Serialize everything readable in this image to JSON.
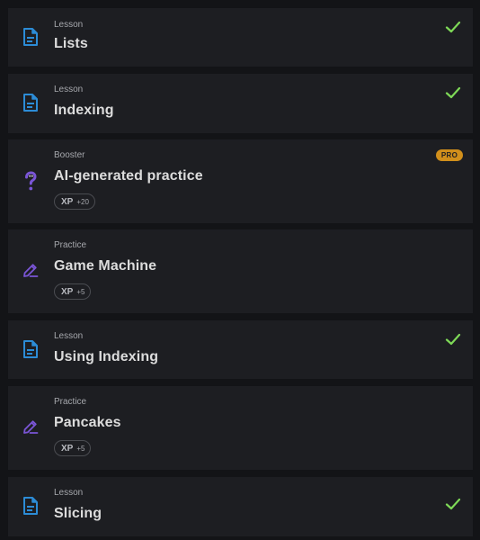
{
  "items": [
    {
      "type": "Lesson",
      "title": "Lists",
      "icon": "document-icon",
      "completed": true
    },
    {
      "type": "Lesson",
      "title": "Indexing",
      "icon": "document-icon",
      "completed": true
    },
    {
      "type": "Booster",
      "title": "AI-generated practice",
      "icon": "question-mark-icon",
      "badge": "PRO",
      "xp_label": "XP",
      "xp_amount": "+20"
    },
    {
      "type": "Practice",
      "title": "Game Machine",
      "icon": "pencil-icon",
      "xp_label": "XP",
      "xp_amount": "+5"
    },
    {
      "type": "Lesson",
      "title": "Using Indexing",
      "icon": "document-icon",
      "completed": true
    },
    {
      "type": "Practice",
      "title": "Pancakes",
      "icon": "pencil-icon",
      "xp_label": "XP",
      "xp_amount": "+5"
    },
    {
      "type": "Lesson",
      "title": "Slicing",
      "icon": "document-icon",
      "completed": true
    }
  ],
  "colors": {
    "card_bg": "#1d1e22",
    "page_bg": "#131417",
    "lesson_icon": "#2c8cd6",
    "practice_icon": "#7a55d6",
    "check": "#7ed957",
    "pro_badge": "#d18f1b"
  }
}
